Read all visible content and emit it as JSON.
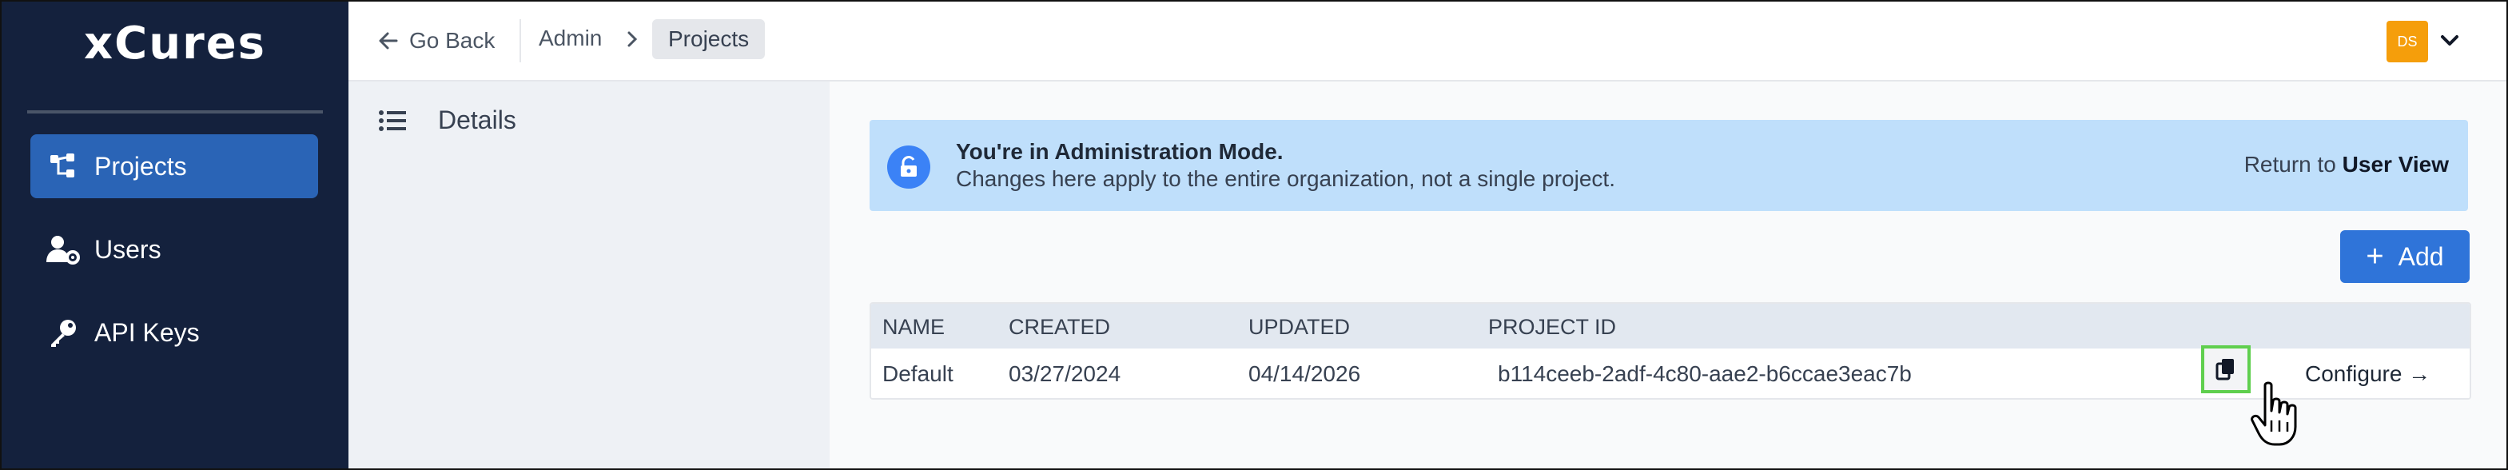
{
  "sidebar": {
    "logo": "xCures",
    "items": [
      {
        "label": "Projects",
        "icon": "projects-icon",
        "active": true
      },
      {
        "label": "Users",
        "icon": "users-gear-icon",
        "active": false
      },
      {
        "label": "API Keys",
        "icon": "key-icon",
        "active": false
      }
    ]
  },
  "header": {
    "back_label": "Go Back",
    "breadcrumb": [
      "Admin",
      "Projects"
    ],
    "user_initials": "DS"
  },
  "subnav": {
    "details_label": "Details"
  },
  "banner": {
    "title": "You're in Administration Mode.",
    "message": "Changes here apply to the entire organization, not a single project.",
    "return_prefix": "Return to",
    "return_link": "User View"
  },
  "actions": {
    "add_label": "Add"
  },
  "table": {
    "columns": [
      "NAME",
      "CREATED",
      "UPDATED",
      "PROJECT ID"
    ],
    "rows": [
      {
        "name": "Default",
        "created": "03/27/2024",
        "updated": "04/14/2026",
        "project_id": "b114ceeb-2adf-4c80-aae2-b6ccae3eac7b",
        "configure_label": "Configure →"
      }
    ]
  },
  "colors": {
    "sidebar_bg": "#14213d",
    "active_item": "#2a64b6",
    "banner_bg": "#bfdffb",
    "primary_button": "#2f74d9",
    "avatar": "#f59e0b",
    "highlight_outline": "#5fcf4e"
  }
}
